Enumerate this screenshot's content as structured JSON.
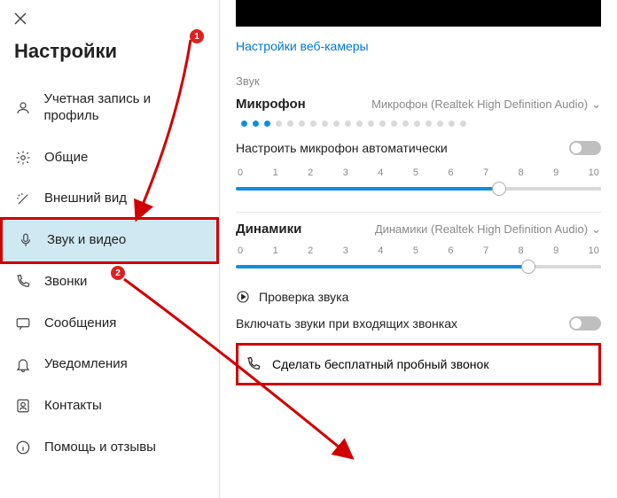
{
  "sidebar": {
    "title": "Настройки",
    "items": [
      {
        "label": "Учетная запись и профиль"
      },
      {
        "label": "Общие"
      },
      {
        "label": "Внешний вид"
      },
      {
        "label": "Звук и видео"
      },
      {
        "label": "Звонки"
      },
      {
        "label": "Сообщения"
      },
      {
        "label": "Уведомления"
      },
      {
        "label": "Контакты"
      },
      {
        "label": "Помощь и отзывы"
      }
    ]
  },
  "main": {
    "webcam_link": "Настройки веб-камеры",
    "sound_section": "Звук",
    "microphone_label": "Микрофон",
    "microphone_device": "Микрофон (Realtek High Definition Audio)",
    "auto_mic_label": "Настроить микрофон автоматически",
    "speakers_label": "Динамики",
    "speakers_device": "Динамики (Realtek High Definition Audio)",
    "sound_test": "Проверка звука",
    "incoming_sound": "Включать звуки при входящих звонках",
    "free_call": "Сделать бесплатный пробный звонок",
    "scale": [
      "0",
      "1",
      "2",
      "3",
      "4",
      "5",
      "6",
      "7",
      "8",
      "9",
      "10"
    ]
  },
  "annotations": {
    "badge1": "1",
    "badge2": "2"
  }
}
